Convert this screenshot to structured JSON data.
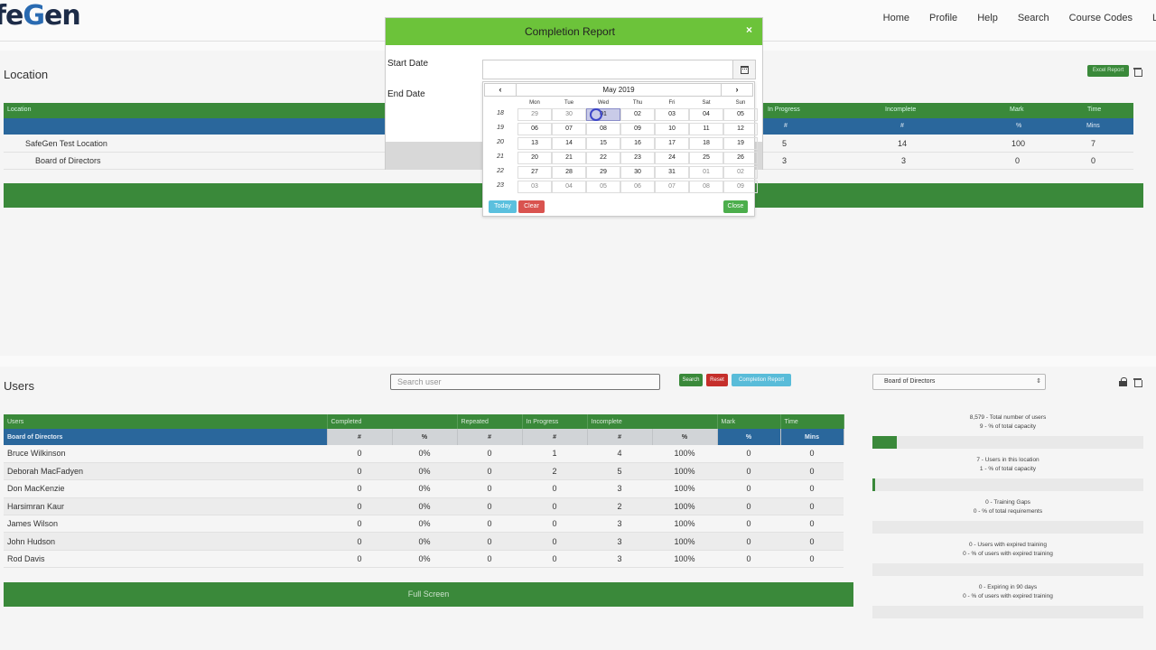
{
  "app": {
    "logo_text": "feGen",
    "logo_accent": "G"
  },
  "nav": {
    "items": [
      "Home",
      "Profile",
      "Help",
      "Search",
      "Course Codes"
    ]
  },
  "location": {
    "title": "Location",
    "excel_label": "Excel Report",
    "headers": {
      "location": "Location",
      "in_progress": "In Progress",
      "incomplete": "Incomplete",
      "mark": "Mark",
      "time": "Time"
    },
    "subheaders": {
      "in_progress": "#",
      "incomplete": "#",
      "mark": "%",
      "time": "Mins"
    },
    "rows": [
      {
        "name": "SafeGen Test Location",
        "in_progress": "5",
        "incomplete": "14",
        "mark": "100",
        "time": "7"
      },
      {
        "name": "Board of Directors",
        "in_progress": "3",
        "incomplete": "3",
        "mark": "0",
        "time": "0"
      }
    ]
  },
  "users": {
    "title": "Users",
    "search_placeholder": "Search user",
    "search_btn": "Search",
    "reset_btn": "Reset",
    "completion_btn": "Completion Report",
    "location_select": "Board of Directors",
    "headers": [
      "Users",
      "Completed",
      "Repeated",
      "In Progress",
      "Incomplete",
      "Mark",
      "Time"
    ],
    "group_label": "Board of Directors",
    "subheaders": [
      "#",
      "%",
      "#",
      "#",
      "#",
      "%",
      "%",
      "Mins"
    ],
    "rows": [
      [
        "Bruce Wilkinson",
        "0",
        "0%",
        "0",
        "1",
        "4",
        "100%",
        "0",
        "0"
      ],
      [
        "Deborah MacFadyen",
        "0",
        "0%",
        "0",
        "2",
        "5",
        "100%",
        "0",
        "0"
      ],
      [
        "Don MacKenzie",
        "0",
        "0%",
        "0",
        "0",
        "3",
        "100%",
        "0",
        "0"
      ],
      [
        "Harsimran Kaur",
        "0",
        "0%",
        "0",
        "0",
        "2",
        "100%",
        "0",
        "0"
      ],
      [
        "James Wilson",
        "0",
        "0%",
        "0",
        "0",
        "3",
        "100%",
        "0",
        "0"
      ],
      [
        "John Hudson",
        "0",
        "0%",
        "0",
        "0",
        "3",
        "100%",
        "0",
        "0"
      ],
      [
        "Rod Davis",
        "0",
        "0%",
        "0",
        "0",
        "3",
        "100%",
        "0",
        "0"
      ]
    ],
    "fullscreen_label": "Full Screen"
  },
  "stats": [
    {
      "l1": "8,579 - Total number of users",
      "l2": "9 - % of total capacity",
      "fill_pct": 9
    },
    {
      "l1": "7 - Users in this location",
      "l2": "1 - % of total capacity",
      "fill_pct": 1
    },
    {
      "l1": "0 - Training Gaps",
      "l2": "0 - % of total requirements",
      "fill_pct": 0
    },
    {
      "l1": "0 - Users with expired training",
      "l2": "0 - % of users with expired training",
      "fill_pct": 0
    },
    {
      "l1": "0 - Expiring in 90 days",
      "l2": "0 - % of users with expired training",
      "fill_pct": 0
    }
  ],
  "modal": {
    "title": "Completion Report",
    "close_glyph": "×",
    "start_label": "Start Date",
    "end_label": "End Date",
    "start_value": ""
  },
  "datepicker": {
    "month_title": "May 2019",
    "prev_glyph": "‹",
    "next_glyph": "›",
    "weekdays": [
      "Mon",
      "Tue",
      "Wed",
      "Thu",
      "Fri",
      "Sat",
      "Sun"
    ],
    "weeks": [
      {
        "wk": "18",
        "days": [
          "29",
          "30",
          "01",
          "02",
          "03",
          "04",
          "05"
        ]
      },
      {
        "wk": "19",
        "days": [
          "06",
          "07",
          "08",
          "09",
          "10",
          "11",
          "12"
        ]
      },
      {
        "wk": "20",
        "days": [
          "13",
          "14",
          "15",
          "16",
          "17",
          "18",
          "19"
        ]
      },
      {
        "wk": "21",
        "days": [
          "20",
          "21",
          "22",
          "23",
          "24",
          "25",
          "26"
        ]
      },
      {
        "wk": "22",
        "days": [
          "27",
          "28",
          "29",
          "30",
          "31",
          "01",
          "02"
        ]
      },
      {
        "wk": "23",
        "days": [
          "03",
          "04",
          "05",
          "06",
          "07",
          "08",
          "09"
        ]
      }
    ],
    "today_btn": "Today",
    "clear_btn": "Clear",
    "close_btn": "Close",
    "colors": {
      "today": "#5bc0de",
      "clear": "#d9534f",
      "close": "#4cae4c",
      "green": "#3c8c3c",
      "blue": "#2b6aa0"
    }
  }
}
